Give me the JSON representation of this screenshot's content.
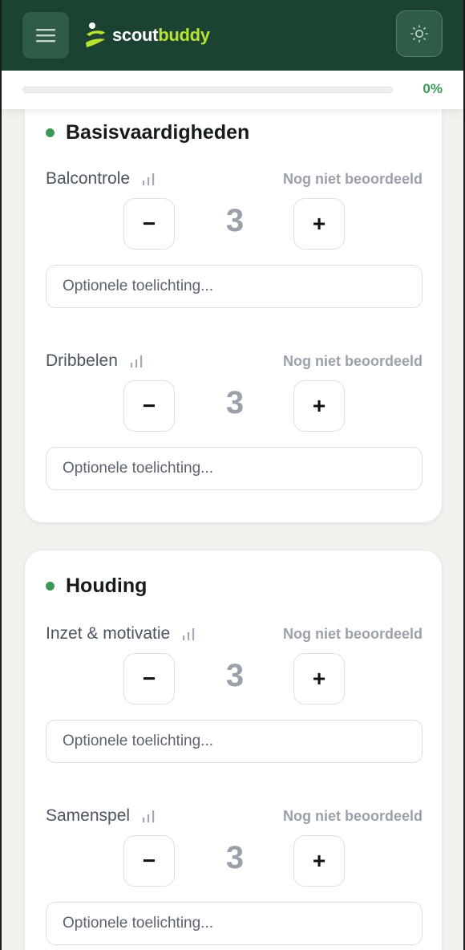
{
  "header": {
    "logo_part1": "scout",
    "logo_part2": "buddy",
    "menu_icon": "hamburger-icon",
    "theme_icon": "sun-icon",
    "colors": {
      "bg": "#1c4331",
      "accent": "#b8e234"
    }
  },
  "progress": {
    "percent_label": "0%",
    "value": 0,
    "color": "#3a9a55"
  },
  "sections": [
    {
      "title": "Basisvaardigheden",
      "skills": [
        {
          "name": "Balcontrole",
          "status": "Nog niet beoordeeld",
          "value": "3",
          "minus": "−",
          "plus": "+",
          "placeholder": "Optionele toelichting..."
        },
        {
          "name": "Dribbelen",
          "status": "Nog niet beoordeeld",
          "value": "3",
          "minus": "−",
          "plus": "+",
          "placeholder": "Optionele toelichting..."
        }
      ]
    },
    {
      "title": "Houding",
      "skills": [
        {
          "name": "Inzet & motivatie",
          "status": "Nog niet beoordeeld",
          "value": "3",
          "minus": "−",
          "plus": "+",
          "placeholder": "Optionele toelichting..."
        },
        {
          "name": "Samenspel",
          "status": "Nog niet beoordeeld",
          "value": "3",
          "minus": "−",
          "plus": "+",
          "placeholder": "Optionele toelichting..."
        }
      ]
    }
  ]
}
